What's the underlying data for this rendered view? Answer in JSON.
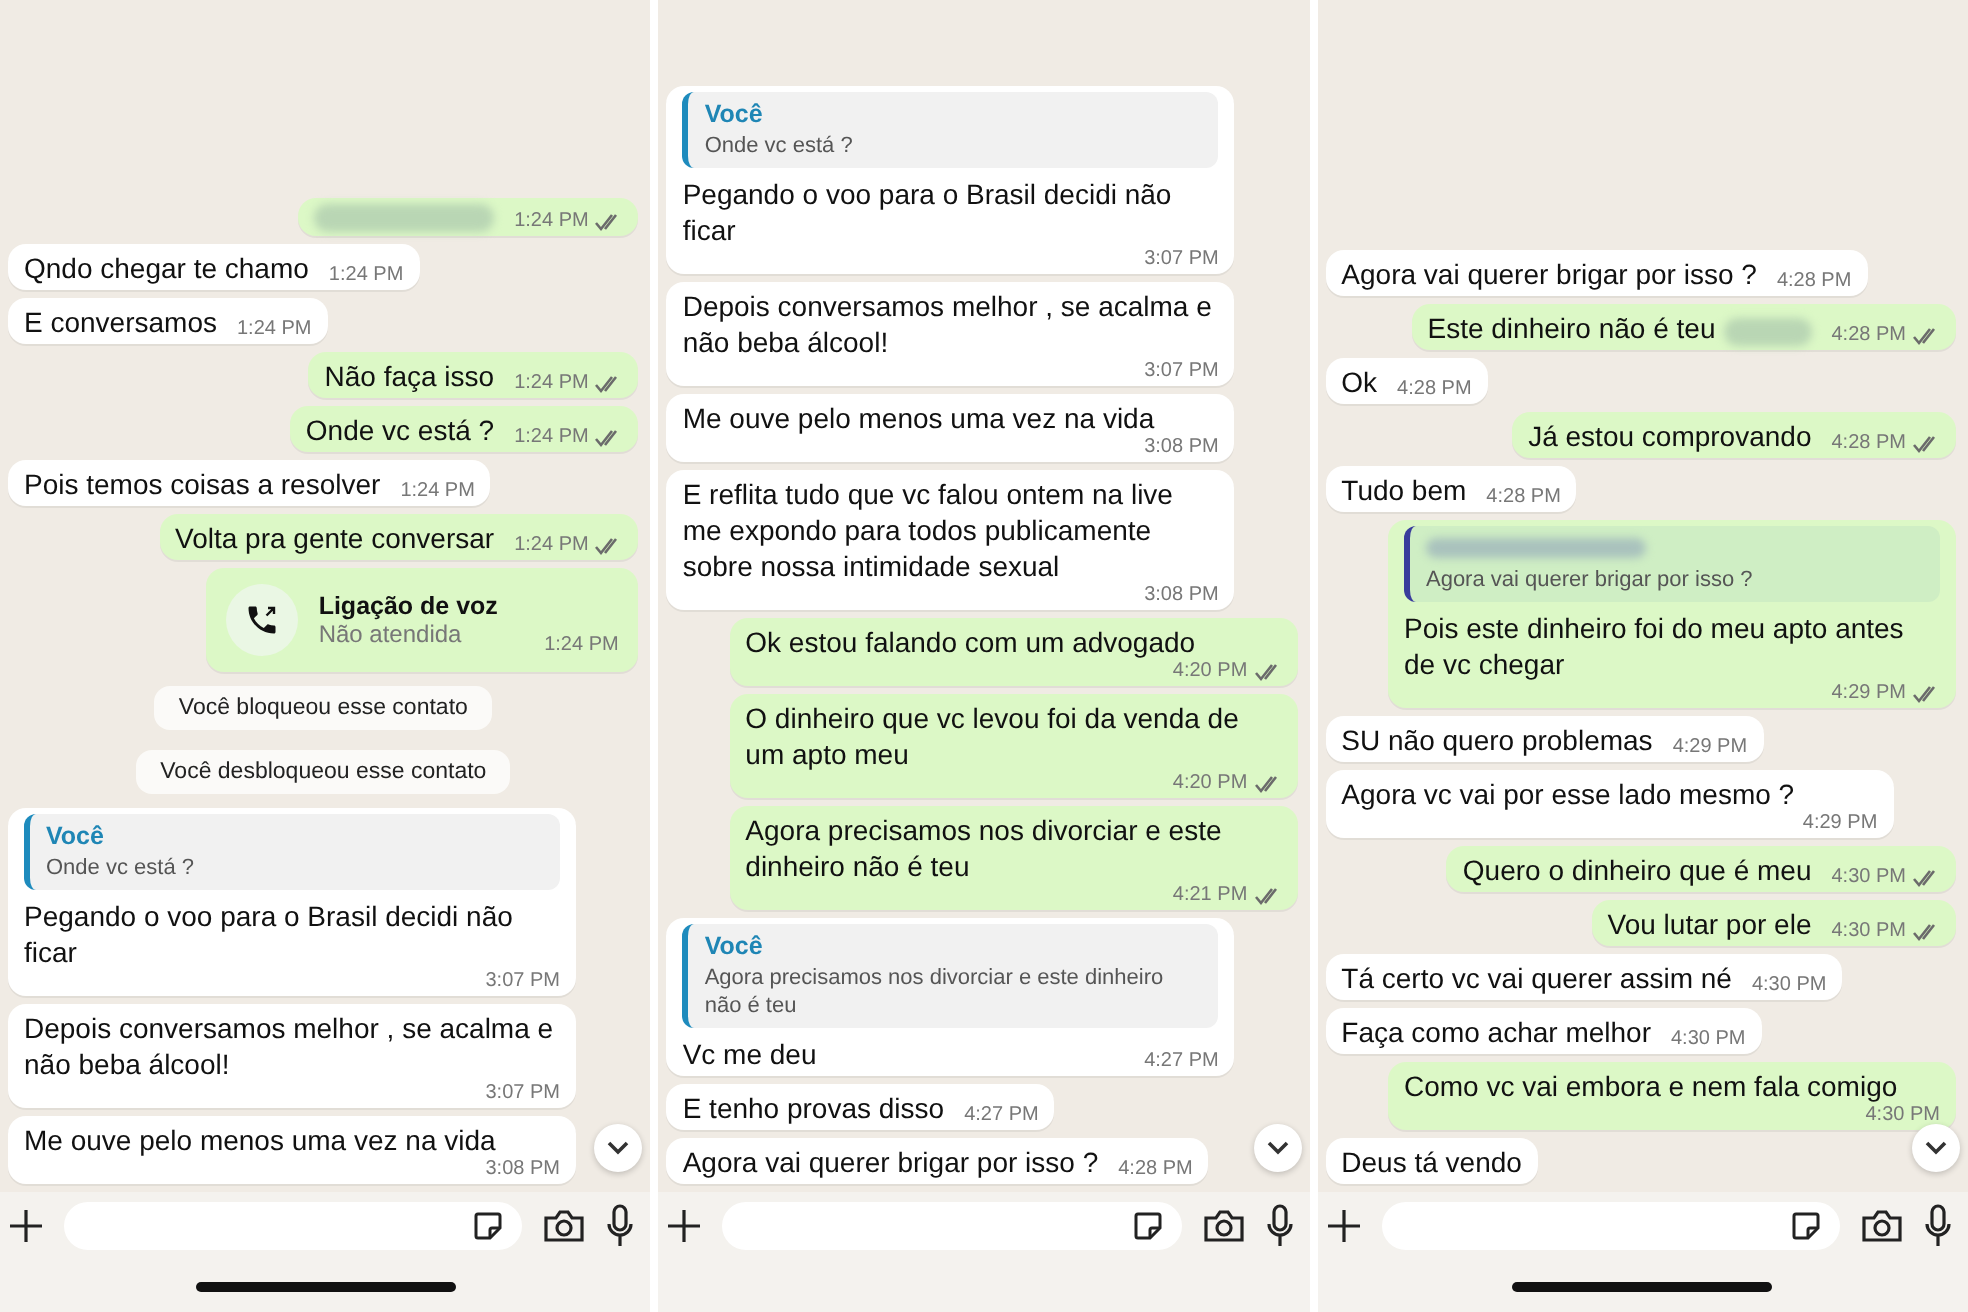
{
  "panels": [
    {
      "home_indicator": true,
      "messages": [
        {
          "kind": "redacted",
          "time": "1:24 PM",
          "ticks": true
        },
        {
          "kind": "incoming",
          "text": "Qndo chegar te chamo",
          "time": "1:24 PM"
        },
        {
          "kind": "incoming",
          "text": "E conversamos",
          "time": "1:24 PM"
        },
        {
          "kind": "outgoing",
          "text": "Não faça isso",
          "time": "1:24 PM",
          "ticks": true
        },
        {
          "kind": "outgoing",
          "text": "Onde vc está ?",
          "time": "1:24 PM",
          "ticks": true
        },
        {
          "kind": "incoming",
          "text": "Pois temos coisas a resolver",
          "time": "1:24 PM"
        },
        {
          "kind": "outgoing",
          "text": "Volta pra gente conversar",
          "time": "1:24 PM",
          "ticks": true
        },
        {
          "kind": "call",
          "title": "Ligação de voz",
          "subtitle": "Não atendida",
          "time": "1:24 PM"
        },
        {
          "kind": "system",
          "text": "Você bloqueou esse contato"
        },
        {
          "kind": "system",
          "text": "Você desbloqueou esse contato"
        },
        {
          "kind": "incoming",
          "quote": {
            "author": "Você",
            "text": "Onde vc está ?"
          },
          "text": "Pegando o voo para o Brasil decidi não ficar",
          "time": "3:07 PM"
        },
        {
          "kind": "incoming",
          "text": "Depois conversamos melhor , se acalma e não beba álcool!",
          "time": "3:07 PM"
        },
        {
          "kind": "incoming",
          "text": "Me ouve pelo menos uma vez na vida",
          "time": "3:08 PM"
        }
      ]
    },
    {
      "home_indicator": false,
      "messages": [
        {
          "kind": "incoming",
          "quote": {
            "author": "Você",
            "text": "Onde vc está ?"
          },
          "text": "Pegando o voo para o Brasil decidi não ficar",
          "time": "3:07 PM"
        },
        {
          "kind": "incoming",
          "text": "Depois conversamos melhor , se acalma e não beba álcool!",
          "time": "3:07 PM"
        },
        {
          "kind": "incoming",
          "text": "Me ouve pelo menos uma vez na vida",
          "time": "3:08 PM"
        },
        {
          "kind": "incoming",
          "text": "E reflita tudo que vc falou ontem na live me expondo para todos publicamente sobre nossa intimidade sexual",
          "time": "3:08 PM"
        },
        {
          "kind": "outgoing",
          "text": "Ok estou falando com um advogado",
          "time": "4:20 PM",
          "ticks": true
        },
        {
          "kind": "outgoing",
          "text": "O dinheiro que vc levou foi da venda de um apto meu",
          "time": "4:20 PM",
          "ticks": true
        },
        {
          "kind": "outgoing",
          "text": "Agora precisamos nos divorciar e este dinheiro não é teu",
          "time": "4:21 PM",
          "ticks": true
        },
        {
          "kind": "incoming",
          "quote": {
            "author": "Você",
            "text": "Agora precisamos nos divorciar e este dinheiro não é teu"
          },
          "text": "Vc me deu",
          "time": "4:27 PM"
        },
        {
          "kind": "incoming",
          "text": "E tenho provas disso",
          "time": "4:27 PM"
        },
        {
          "kind": "incoming",
          "text": "Agora vai querer brigar por isso ?",
          "time": "4:28 PM"
        }
      ]
    },
    {
      "home_indicator": true,
      "messages": [
        {
          "kind": "incoming",
          "text": "Agora vai querer brigar por isso ?",
          "time": "4:28 PM"
        },
        {
          "kind": "outgoing",
          "text": "Este dinheiro não é teu",
          "redacted_tail": true,
          "time": "4:28 PM",
          "ticks": true
        },
        {
          "kind": "incoming",
          "text": "Ok",
          "time": "4:28 PM"
        },
        {
          "kind": "outgoing",
          "text": "Já estou comprovando",
          "time": "4:28 PM",
          "ticks": true
        },
        {
          "kind": "incoming",
          "text": "Tudo bem",
          "time": "4:28 PM"
        },
        {
          "kind": "outgoing",
          "quote": {
            "author_redacted": true,
            "text": "Agora vai querer brigar por isso ?"
          },
          "text": "Pois este dinheiro foi do meu apto antes de vc chegar",
          "time": "4:29 PM",
          "ticks": true
        },
        {
          "kind": "incoming",
          "text": "SU não quero problemas",
          "time": "4:29 PM"
        },
        {
          "kind": "incoming",
          "text": "Agora vc vai por esse lado mesmo ?",
          "time": "4:29 PM"
        },
        {
          "kind": "outgoing",
          "text": "Quero o dinheiro que é meu",
          "time": "4:30 PM",
          "ticks": true
        },
        {
          "kind": "outgoing",
          "text": "Vou lutar por ele",
          "time": "4:30 PM",
          "ticks": true
        },
        {
          "kind": "incoming",
          "text": "Tá certo vc vai querer assim né",
          "time": "4:30 PM"
        },
        {
          "kind": "incoming",
          "text": "Faça como achar melhor",
          "time": "4:30 PM"
        },
        {
          "kind": "outgoing",
          "text": "Como vc vai embora e nem fala comigo",
          "time": "4:30 PM",
          "ticks": false
        },
        {
          "kind": "incoming",
          "text": "Deus tá vendo"
        }
      ]
    }
  ]
}
